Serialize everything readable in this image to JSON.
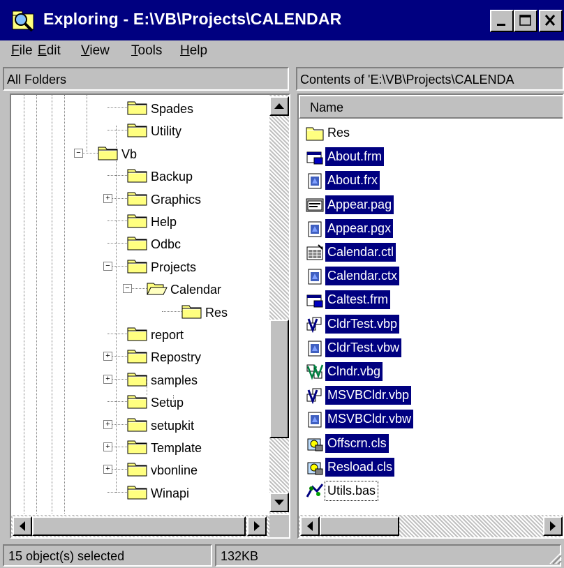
{
  "window": {
    "title": "Exploring - E:\\VB\\Projects\\CALENDAR",
    "controls": {
      "minimize": "minimize-icon",
      "maximize": "maximize-icon",
      "close": "close-icon"
    },
    "colors": {
      "titlebar": "#000080",
      "face": "#c0c0c0",
      "selection": "#000080"
    }
  },
  "menu": [
    {
      "key": "F",
      "rest": "ile"
    },
    {
      "key": "E",
      "rest": "dit"
    },
    {
      "key": "V",
      "rest": "iew"
    },
    {
      "key": "T",
      "rest": "ools"
    },
    {
      "key": "H",
      "rest": "elp"
    }
  ],
  "folders_header": "All Folders",
  "contents_header": "Contents of 'E:\\VB\\Projects\\CALENDA",
  "tree": [
    {
      "label": "Spades",
      "expander": ""
    },
    {
      "label": "Utility",
      "expander": ""
    },
    {
      "label": "Vb",
      "expander": "−"
    },
    {
      "label": "Backup",
      "expander": ""
    },
    {
      "label": "Graphics",
      "expander": "+"
    },
    {
      "label": "Help",
      "expander": ""
    },
    {
      "label": "Odbc",
      "expander": ""
    },
    {
      "label": "Projects",
      "expander": "−"
    },
    {
      "label": "Calendar",
      "expander": "−"
    },
    {
      "label": "Res",
      "expander": ""
    },
    {
      "label": "report",
      "expander": ""
    },
    {
      "label": "Repostry",
      "expander": "+"
    },
    {
      "label": "samples",
      "expander": "+"
    },
    {
      "label": "Setup",
      "expander": ""
    },
    {
      "label": "setupkit",
      "expander": "+"
    },
    {
      "label": "Template",
      "expander": "+"
    },
    {
      "label": "vbonline",
      "expander": "+"
    },
    {
      "label": "Winapi",
      "expander": ""
    }
  ],
  "list_header": "Name",
  "files": [
    {
      "name": "Res",
      "icon": "folder-icon",
      "selected": false
    },
    {
      "name": "About.frm",
      "icon": "form-icon",
      "selected": true
    },
    {
      "name": "About.frx",
      "icon": "binary-file-icon",
      "selected": true
    },
    {
      "name": "Appear.pag",
      "icon": "property-page-icon",
      "selected": true
    },
    {
      "name": "Appear.pgx",
      "icon": "binary-file-icon",
      "selected": true
    },
    {
      "name": "Calendar.ctl",
      "icon": "user-control-icon",
      "selected": true
    },
    {
      "name": "Calendar.ctx",
      "icon": "binary-file-icon",
      "selected": true
    },
    {
      "name": "Caltest.frm",
      "icon": "form-icon",
      "selected": true
    },
    {
      "name": "CldrTest.vbp",
      "icon": "vb-project-icon",
      "selected": true
    },
    {
      "name": "CldrTest.vbw",
      "icon": "binary-file-icon",
      "selected": true
    },
    {
      "name": "Clndr.vbg",
      "icon": "vb-group-icon",
      "selected": true
    },
    {
      "name": "MSVBCldr.vbp",
      "icon": "vb-project-icon",
      "selected": true
    },
    {
      "name": "MSVBCldr.vbw",
      "icon": "binary-file-icon",
      "selected": true
    },
    {
      "name": "Offscrn.cls",
      "icon": "class-module-icon",
      "selected": true
    },
    {
      "name": "Resload.cls",
      "icon": "class-module-icon",
      "selected": true
    },
    {
      "name": "Utils.bas",
      "icon": "module-icon",
      "selected": false
    }
  ],
  "status": {
    "selection": "15 object(s) selected",
    "size": "132KB"
  }
}
